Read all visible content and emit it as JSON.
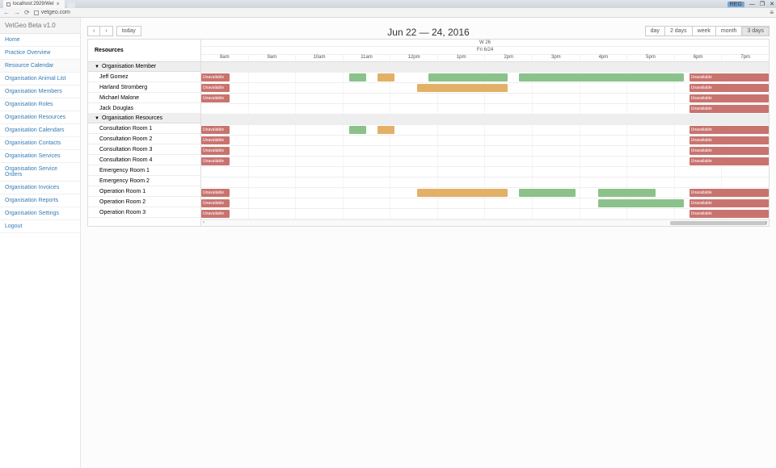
{
  "browser": {
    "tab_title": "localhost:2929/Wel",
    "url": "vetgeo.com",
    "reg_badge": "REG"
  },
  "brand": "VetGeo Beta v1.0",
  "sidebar": {
    "items": [
      {
        "label": "Home"
      },
      {
        "label": "Practice Overview"
      },
      {
        "label": "Resource Calendar"
      },
      {
        "label": "Organisation Animal List"
      },
      {
        "label": "Organisation Members"
      },
      {
        "label": "Organisation Roles"
      },
      {
        "label": "Organisation Resources"
      },
      {
        "label": "Organisation Calendars"
      },
      {
        "label": "Organisation Contacts"
      },
      {
        "label": "Organisation Services"
      },
      {
        "label": "Organisation Service Orders"
      },
      {
        "label": "Organisation Invoices"
      },
      {
        "label": "Organisation Reports"
      },
      {
        "label": "Organisation Settings"
      },
      {
        "label": "Logout"
      }
    ],
    "active_index": 2
  },
  "calendar": {
    "title": "Jun 22 — 24, 2016",
    "today_label": "today",
    "view_buttons": [
      "day",
      "2 days",
      "week",
      "month",
      "3 days"
    ],
    "active_view_index": 4,
    "resources_header": "Resources",
    "week_label": "W 26",
    "day_label": "Fri 6/24",
    "time_slots": [
      "8am",
      "9am",
      "10am",
      "11am",
      "12pm",
      "1pm",
      "2pm",
      "3pm",
      "4pm",
      "5pm",
      "6pm",
      "7pm"
    ],
    "unavailable_label": "Unavailable",
    "groups": [
      {
        "name": "Organisation Member",
        "rows": [
          {
            "name": "Jeff Gomez",
            "events": [
              {
                "type": "red",
                "start": 0,
                "end": 5,
                "label": "Unavailable"
              },
              {
                "type": "green",
                "start": 26,
                "end": 29
              },
              {
                "type": "orange",
                "start": 31,
                "end": 34
              },
              {
                "type": "green",
                "start": 40,
                "end": 54
              },
              {
                "type": "green",
                "start": 56,
                "end": 85
              },
              {
                "type": "red",
                "start": 86,
                "end": 100,
                "label": "Unavailable"
              }
            ]
          },
          {
            "name": "Harland Stromberg",
            "events": [
              {
                "type": "red",
                "start": 0,
                "end": 5,
                "label": "Unavailable"
              },
              {
                "type": "orange",
                "start": 38,
                "end": 54
              },
              {
                "type": "red",
                "start": 86,
                "end": 100,
                "label": "Unavailable"
              }
            ]
          },
          {
            "name": "Michael Malone",
            "events": [
              {
                "type": "red",
                "start": 0,
                "end": 5,
                "label": "Unavailable"
              },
              {
                "type": "red",
                "start": 86,
                "end": 100,
                "label": "Unavailable"
              }
            ]
          },
          {
            "name": "Jack Douglas",
            "events": [
              {
                "type": "red",
                "start": 86,
                "end": 100,
                "label": "Unavailable"
              }
            ]
          }
        ]
      },
      {
        "name": "Organisation Resources",
        "rows": [
          {
            "name": "Consultation Room 1",
            "events": [
              {
                "type": "red",
                "start": 0,
                "end": 5,
                "label": "Unavailable"
              },
              {
                "type": "green",
                "start": 26,
                "end": 29
              },
              {
                "type": "orange",
                "start": 31,
                "end": 34
              },
              {
                "type": "red",
                "start": 86,
                "end": 100,
                "label": "Unavailable"
              }
            ]
          },
          {
            "name": "Consultation Room 2",
            "events": [
              {
                "type": "red",
                "start": 0,
                "end": 5,
                "label": "Unavailable"
              },
              {
                "type": "red",
                "start": 86,
                "end": 100,
                "label": "Unavailable"
              }
            ]
          },
          {
            "name": "Consultation Room 3",
            "events": [
              {
                "type": "red",
                "start": 0,
                "end": 5,
                "label": "Unavailable"
              },
              {
                "type": "red",
                "start": 86,
                "end": 100,
                "label": "Unavailable"
              }
            ]
          },
          {
            "name": "Consultation Room 4",
            "events": [
              {
                "type": "red",
                "start": 0,
                "end": 5,
                "label": "Unavailable"
              },
              {
                "type": "red",
                "start": 86,
                "end": 100,
                "label": "Unavailable"
              }
            ]
          },
          {
            "name": "Emergency Room 1",
            "events": []
          },
          {
            "name": "Emergency Room 2",
            "events": []
          },
          {
            "name": "Operation Room 1",
            "events": [
              {
                "type": "red",
                "start": 0,
                "end": 5,
                "label": "Unavailable"
              },
              {
                "type": "orange",
                "start": 38,
                "end": 54
              },
              {
                "type": "green",
                "start": 56,
                "end": 66
              },
              {
                "type": "green",
                "start": 70,
                "end": 80
              },
              {
                "type": "red",
                "start": 86,
                "end": 100,
                "label": "Unavailable"
              }
            ]
          },
          {
            "name": "Operation Room 2",
            "events": [
              {
                "type": "red",
                "start": 0,
                "end": 5,
                "label": "Unavailable"
              },
              {
                "type": "green",
                "start": 70,
                "end": 85
              },
              {
                "type": "red",
                "start": 86,
                "end": 100,
                "label": "Unavailable"
              }
            ]
          },
          {
            "name": "Operation Room 3",
            "events": [
              {
                "type": "red",
                "start": 0,
                "end": 5,
                "label": "Unavailable"
              },
              {
                "type": "red",
                "start": 86,
                "end": 100,
                "label": "Unavailable"
              }
            ]
          }
        ]
      }
    ]
  }
}
